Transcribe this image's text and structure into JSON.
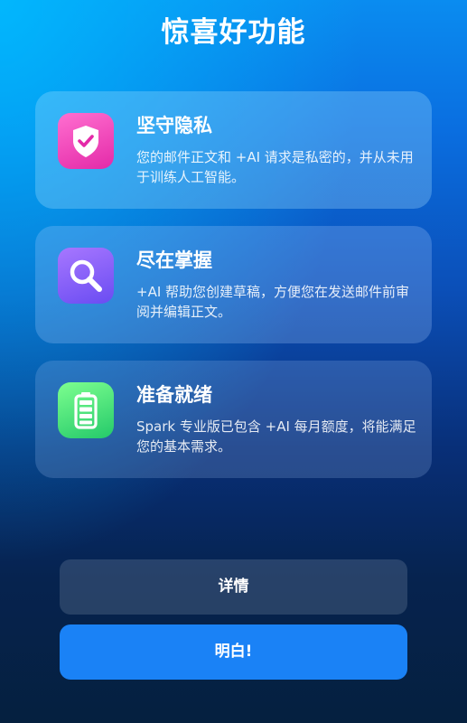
{
  "header": {
    "title": "惊喜好功能"
  },
  "features": [
    {
      "icon": "shield-check-icon",
      "title": "坚守隐私",
      "description": "您的邮件正文和 +AI 请求是私密的，并从未用于训练人工智能。"
    },
    {
      "icon": "magnifier-icon",
      "title": "尽在掌握",
      "description": "+AI 帮助您创建草稿，方便您在发送邮件前审阅并编辑正文。"
    },
    {
      "icon": "battery-full-icon",
      "title": "准备就绪",
      "description": "Spark 专业版已包含 +AI 每月额度，将能满足您的基本需求。"
    }
  ],
  "actions": {
    "details_label": "详情",
    "confirm_label": "明白!"
  },
  "colors": {
    "primary_button": "#1a82f6",
    "privacy_icon": "#e42aa8",
    "control_icon": "#6a4cf2",
    "ready_icon": "#24c96a"
  }
}
